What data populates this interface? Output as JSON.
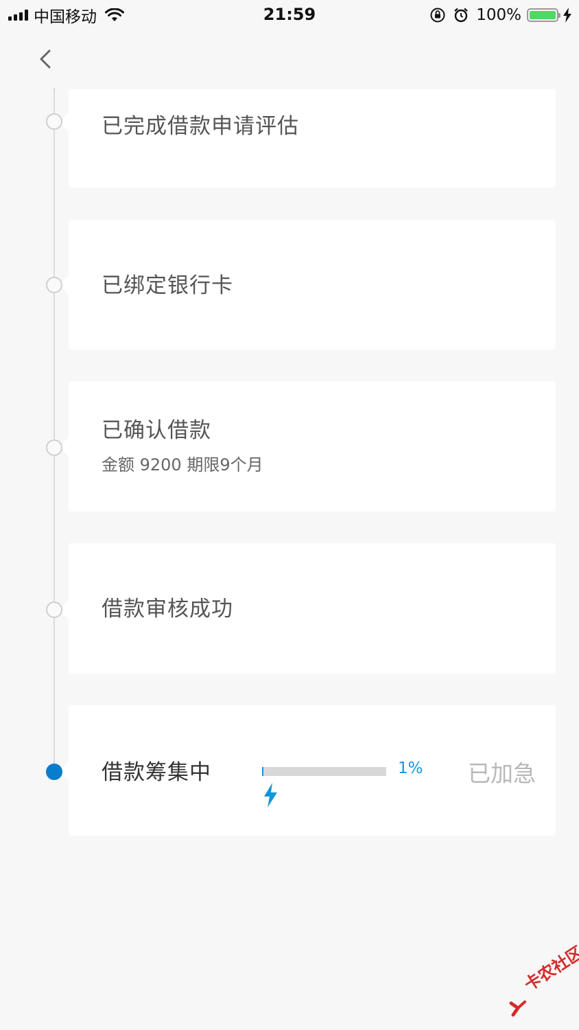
{
  "status_bar": {
    "carrier": "中国移动",
    "time": "21:59",
    "battery_percent": "100%",
    "battery_level": 1.0,
    "icons": [
      "signal-icon",
      "wifi-icon",
      "rotation-lock-icon",
      "alarm-icon",
      "battery-icon",
      "charging-icon"
    ]
  },
  "nav": {
    "back_icon": "chevron-left-icon"
  },
  "timeline": {
    "steps": [
      {
        "title": "已完成借款申请评估",
        "status": "done"
      },
      {
        "title": "已绑定银行卡",
        "status": "done"
      },
      {
        "title": "已确认借款",
        "subtitle": "金额 9200  期限9个月",
        "status": "done"
      },
      {
        "title": "借款审核成功",
        "status": "done"
      },
      {
        "title": "借款筹集中",
        "status": "active",
        "progress_percent": 1,
        "progress_label": "1%",
        "action_label": "已加急",
        "bolt_icon": "lightning-bolt-icon"
      }
    ]
  },
  "colors": {
    "accent": "#1296db",
    "active_node": "#0a7ccc",
    "background": "#f7f7f7",
    "card": "#ffffff"
  },
  "watermark": {
    "text": "卡农社区"
  }
}
